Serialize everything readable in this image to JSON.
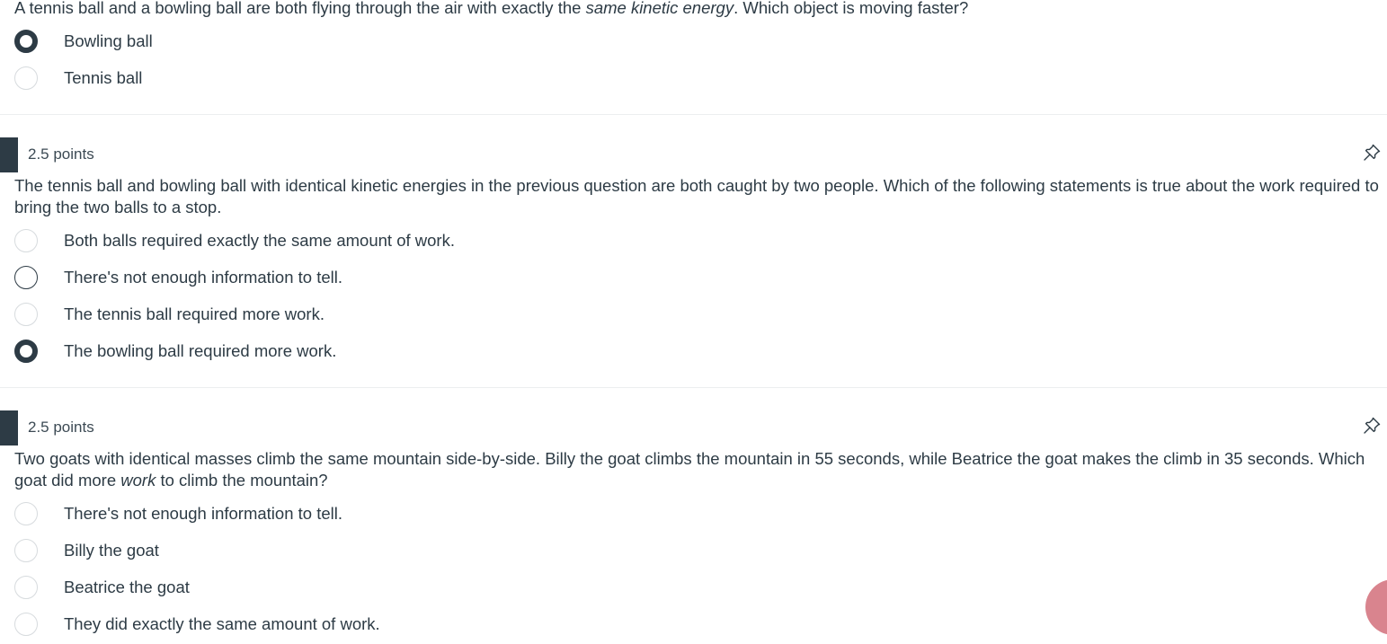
{
  "questions": [
    {
      "stem_parts": [
        "A tennis ball and a bowling ball are both flying through the air with exactly the ",
        "same kinetic energy",
        ". Which object is moving faster?"
      ],
      "answers": [
        {
          "label": "Bowling ball",
          "selected": true
        },
        {
          "label": "Tennis ball",
          "selected": false
        }
      ]
    },
    {
      "points": "2.5 points",
      "stem": "The tennis ball and bowling ball with identical kinetic energies in the previous question are both caught by two people. Which of the following statements is true about the work required to bring the two balls to a stop.",
      "answers": [
        {
          "label": "Both balls required exactly the same amount of work.",
          "selected": false
        },
        {
          "label": "There's not enough information to tell.",
          "selected": false
        },
        {
          "label": "The tennis ball required more work.",
          "selected": false
        },
        {
          "label": "The bowling ball required more work.",
          "selected": true
        }
      ]
    },
    {
      "points": "2.5 points",
      "stem_parts": [
        "Two goats with identical masses climb the same mountain side-by-side. Billy the goat climbs the mountain in 55 seconds, while Beatrice the goat makes the climb in 35 seconds. Which goat did more ",
        "work",
        " to climb the mountain?"
      ],
      "answers": [
        {
          "label": "There's not enough information to tell.",
          "selected": false
        },
        {
          "label": "Billy the goat",
          "selected": false
        },
        {
          "label": "Beatrice the goat",
          "selected": false
        },
        {
          "label": "They did exactly the same amount of work.",
          "selected": false
        }
      ]
    }
  ],
  "colors": {
    "text": "#2d3b45",
    "selected_radio": "#2d3b45",
    "chat_bubble": "#d9848e"
  }
}
